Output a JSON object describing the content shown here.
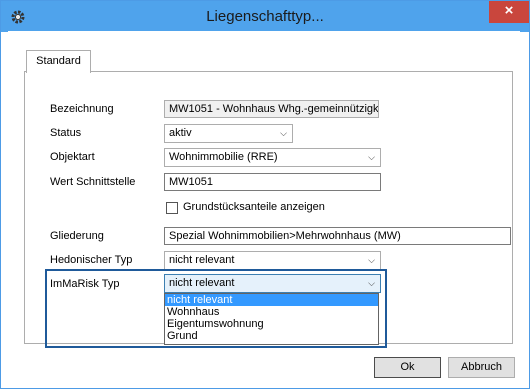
{
  "window": {
    "title": "Liegenschafttyp...",
    "close_glyph": "×",
    "app_icon": "gear-icon"
  },
  "tabs": [
    {
      "label": "Standard"
    }
  ],
  "form": {
    "bezeichnung": {
      "label": "Bezeichnung",
      "value": "MW1051 - Wohnhaus Whg.-gemeinnützigk"
    },
    "status": {
      "label": "Status",
      "value": "aktiv"
    },
    "objektart": {
      "label": "Objektart",
      "value": "Wohnimmobilie (RRE)"
    },
    "schnittstelle": {
      "label": "Wert Schnittstelle",
      "value": "MW1051"
    },
    "grundstuecksanteile": {
      "label": "Grundstücksanteile anzeigen",
      "checked": false
    },
    "gliederung": {
      "label": "Gliederung",
      "value": "Spezial Wohnimmobilien>Mehrwohnhaus (MW)"
    },
    "hedonischer_typ": {
      "label": "Hedonischer Typ",
      "value": "nicht relevant"
    },
    "immarisk_typ": {
      "label": "ImMaRisk Typ",
      "value": "nicht relevant",
      "options": [
        "nicht relevant",
        "Wohnhaus",
        "Eigentumswohnung",
        "Grund"
      ],
      "selected_index": 0
    }
  },
  "buttons": {
    "ok": "Ok",
    "cancel": "Abbruch"
  },
  "colors": {
    "titlebar": "#4fa3ec",
    "close": "#c9463d",
    "selection": "#3399ff",
    "highlight": "#1f5a9a"
  }
}
